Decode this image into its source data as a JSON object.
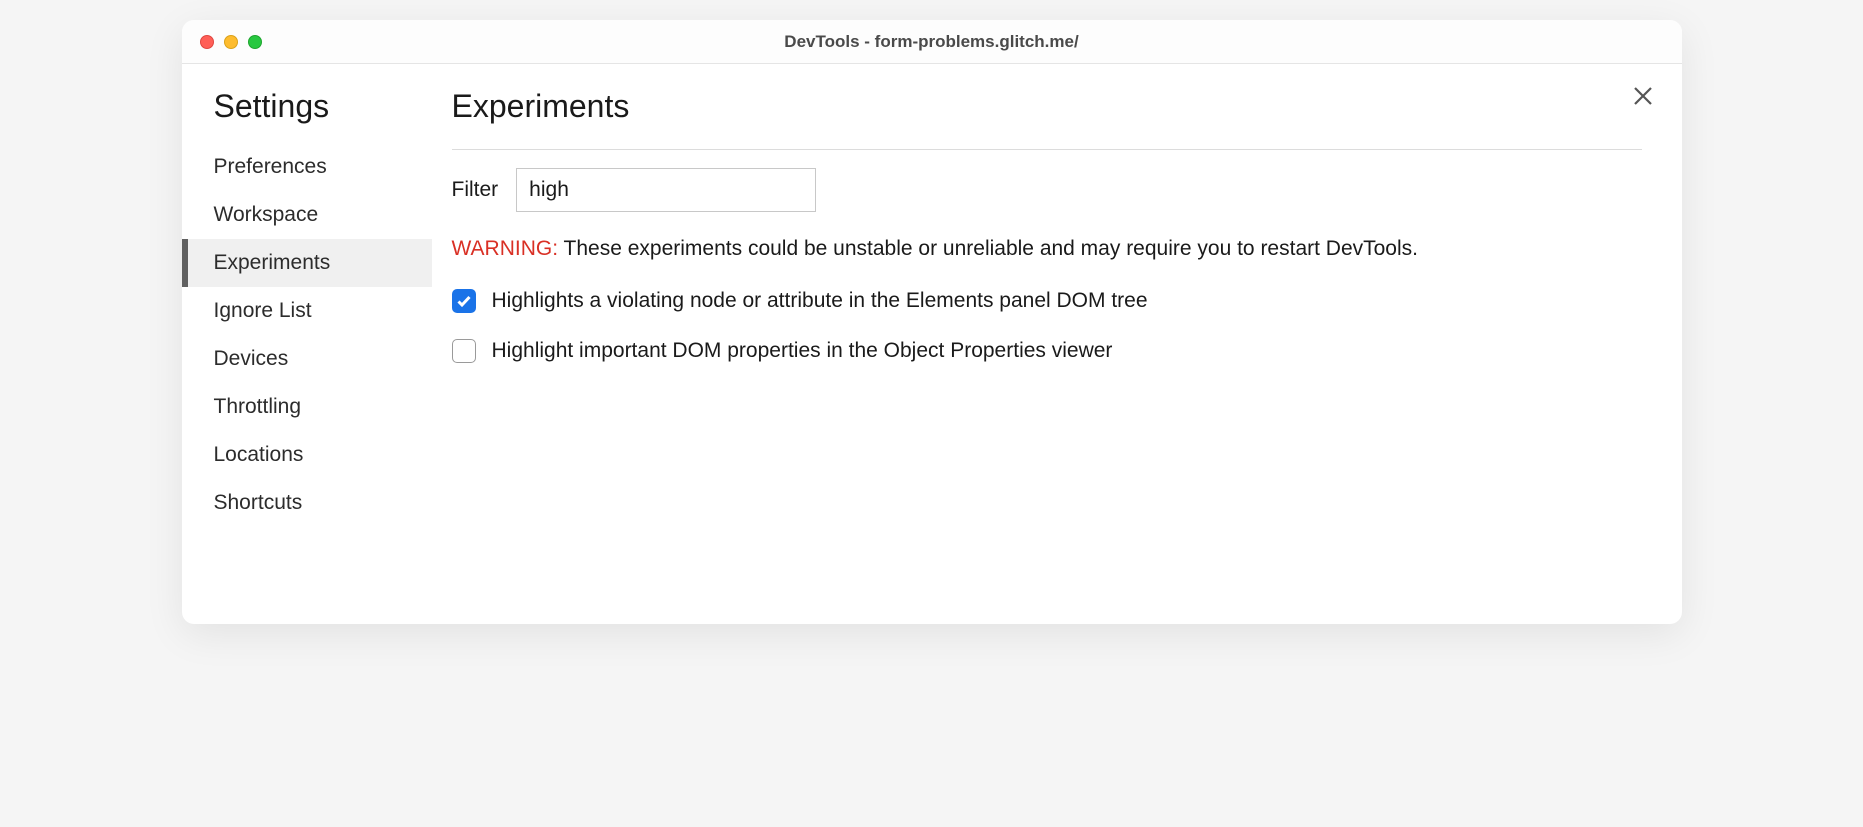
{
  "window": {
    "title": "DevTools - form-problems.glitch.me/"
  },
  "sidebar": {
    "title": "Settings",
    "items": [
      {
        "label": "Preferences",
        "active": false
      },
      {
        "label": "Workspace",
        "active": false
      },
      {
        "label": "Experiments",
        "active": true
      },
      {
        "label": "Ignore List",
        "active": false
      },
      {
        "label": "Devices",
        "active": false
      },
      {
        "label": "Throttling",
        "active": false
      },
      {
        "label": "Locations",
        "active": false
      },
      {
        "label": "Shortcuts",
        "active": false
      }
    ]
  },
  "main": {
    "title": "Experiments",
    "filter": {
      "label": "Filter",
      "value": "high"
    },
    "warning": {
      "label": "WARNING:",
      "text": "These experiments could be unstable or unreliable and may require you to restart DevTools."
    },
    "experiments": [
      {
        "label": "Highlights a violating node or attribute in the Elements panel DOM tree",
        "checked": true
      },
      {
        "label": "Highlight important DOM properties in the Object Properties viewer",
        "checked": false
      }
    ]
  }
}
